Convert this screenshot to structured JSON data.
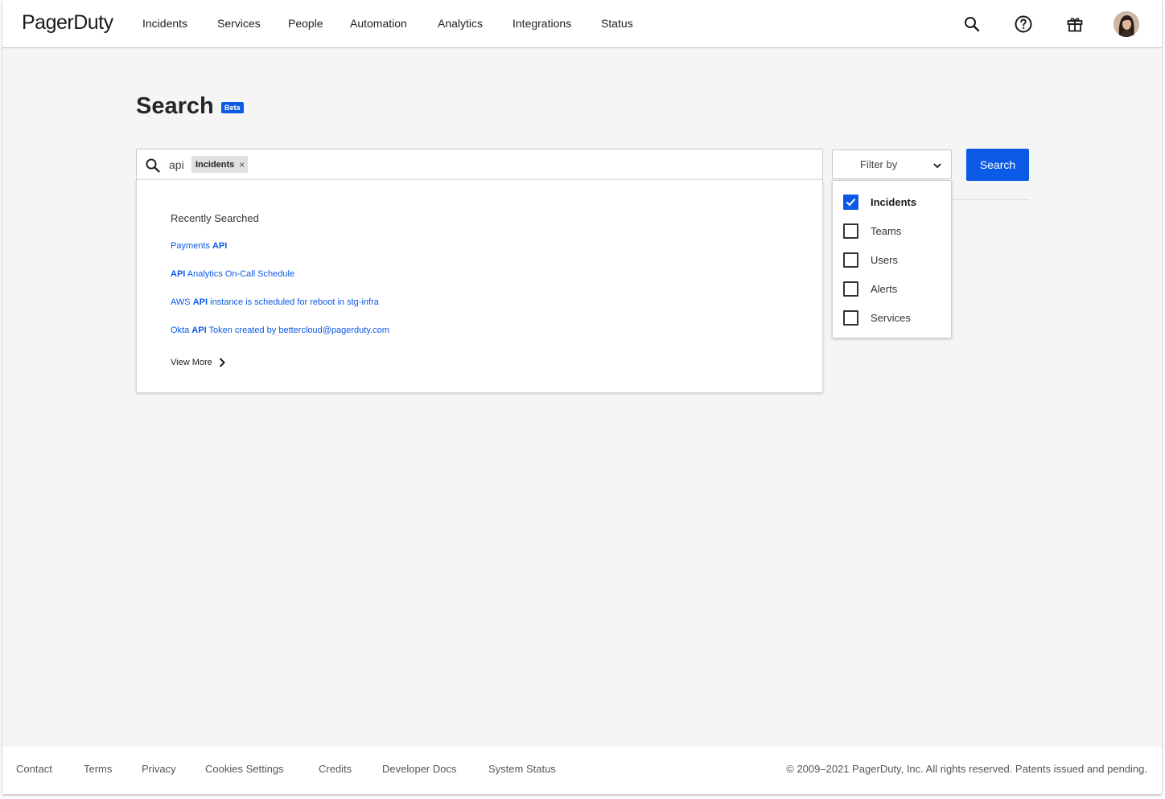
{
  "header": {
    "logo": "PagerDuty",
    "nav": [
      "Incidents",
      "Services",
      "People",
      "Automation",
      "Analytics",
      "Integrations",
      "Status"
    ]
  },
  "page": {
    "title": "Search",
    "badge": "Beta"
  },
  "search": {
    "query": "api",
    "chip_label": "Incidents",
    "chip_remove": "×",
    "button_label": "Search"
  },
  "recent": {
    "heading": "Recently Searched",
    "items": [
      {
        "before": "Payments ",
        "match": "API",
        "after": ""
      },
      {
        "before": "",
        "match": "API",
        "after": " Analytics On-Call Schedule"
      },
      {
        "before": "AWS ",
        "match": "API",
        "after": " instance is scheduled for reboot in stg-infra"
      },
      {
        "before": "Okta ",
        "match": "API",
        "after": " Token created by bettercloud@pagerduty.com"
      }
    ],
    "view_more": "View More"
  },
  "filter": {
    "label": "Filter by",
    "options": [
      {
        "label": "Incidents",
        "checked": true
      },
      {
        "label": "Teams",
        "checked": false
      },
      {
        "label": "Users",
        "checked": false
      },
      {
        "label": "Alerts",
        "checked": false
      },
      {
        "label": "Services",
        "checked": false
      }
    ]
  },
  "footer": {
    "links": [
      "Contact",
      "Terms",
      "Privacy",
      "Cookies Settings",
      "Credits",
      "Developer Docs",
      "System Status"
    ],
    "copyright": "© 2009–2021 PagerDuty, Inc. All rights reserved. Patents issued and pending."
  },
  "colors": {
    "accent": "#0b5ae6",
    "background": "#f5f5f5"
  },
  "icons": {
    "header": [
      "search-icon",
      "help-icon",
      "gift-icon"
    ],
    "search_box": "search-icon",
    "filter_select": "chevron-down-icon",
    "view_more": "chevron-right-icon",
    "checkbox_checked": "checkmark-icon"
  }
}
